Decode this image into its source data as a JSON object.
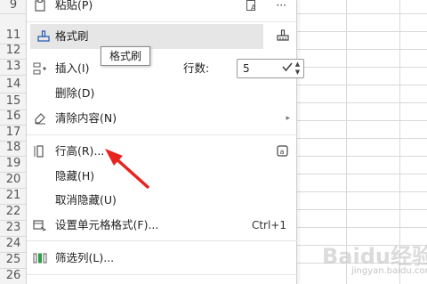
{
  "row_numbers": [
    "9",
    "11",
    "12",
    "13",
    "14",
    "15",
    "16",
    "17",
    "18",
    "19",
    "20",
    "21",
    "22",
    "23",
    "24",
    "25",
    "26"
  ],
  "menu": {
    "paste": {
      "label": "粘贴(P)",
      "right": "···"
    },
    "format_painter": {
      "label": "格式刷",
      "tooltip": "格式刷"
    },
    "insert": {
      "label": "插入(I)",
      "rows_label": "行数:",
      "rows_value": "5"
    },
    "delete": {
      "label": "删除(D)"
    },
    "clear": {
      "label": "清除内容(N)"
    },
    "row_height": {
      "label": "行高(R)..."
    },
    "hide": {
      "label": "隐藏(H)"
    },
    "unhide": {
      "label": "取消隐藏(U)"
    },
    "format_cells": {
      "label": "设置单元格格式(F)...",
      "shortcut": "Ctrl+1"
    },
    "filter_col": {
      "label": "筛选列(L)..."
    }
  },
  "watermark": {
    "main": "Baidu经验",
    "sub": "jingyan.baidu.com"
  },
  "colors": {
    "arrow": "#e8231f",
    "highlight": "#e6e6e6"
  }
}
